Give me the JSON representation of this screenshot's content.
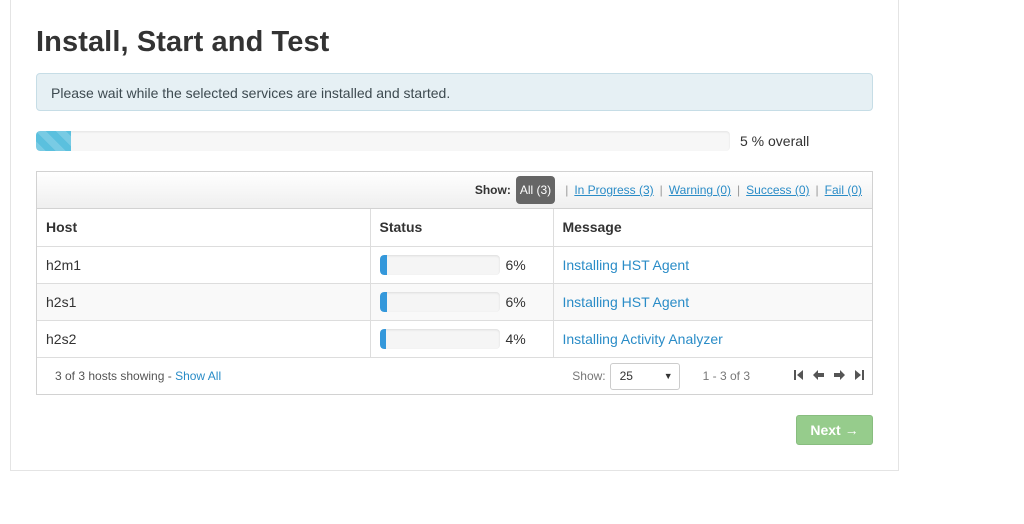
{
  "page": {
    "title": "Install, Start and Test",
    "alert": "Please wait while the selected services are installed and started."
  },
  "overall": {
    "percent": 5,
    "label": "5 % overall",
    "color": "#5bc0de"
  },
  "filters": {
    "show_label": "Show:",
    "all": "All (3)",
    "separator": "|",
    "in_progress": "In Progress (3)",
    "warning": "Warning (0)",
    "success": "Success (0)",
    "fail": "Fail (0)"
  },
  "table": {
    "headers": {
      "host": "Host",
      "status": "Status",
      "message": "Message"
    },
    "rows": [
      {
        "host": "h2m1",
        "percent": 6,
        "percent_label": "6%",
        "message": "Installing HST Agent"
      },
      {
        "host": "h2s1",
        "percent": 6,
        "percent_label": "6%",
        "message": "Installing HST Agent"
      },
      {
        "host": "h2s2",
        "percent": 4,
        "percent_label": "4%",
        "message": "Installing Activity Analyzer"
      }
    ]
  },
  "footer": {
    "count": "3 of 3 hosts showing - ",
    "show_all": "Show All",
    "show_label": "Show:",
    "per_page": "25",
    "range": "1 - 3 of 3",
    "pager": {
      "first": "first-page-icon",
      "prev": "prev-page-icon",
      "next": "next-page-icon",
      "last": "last-page-icon"
    }
  },
  "buttons": {
    "next": "Next →",
    "next_color": "#96cc8c"
  }
}
